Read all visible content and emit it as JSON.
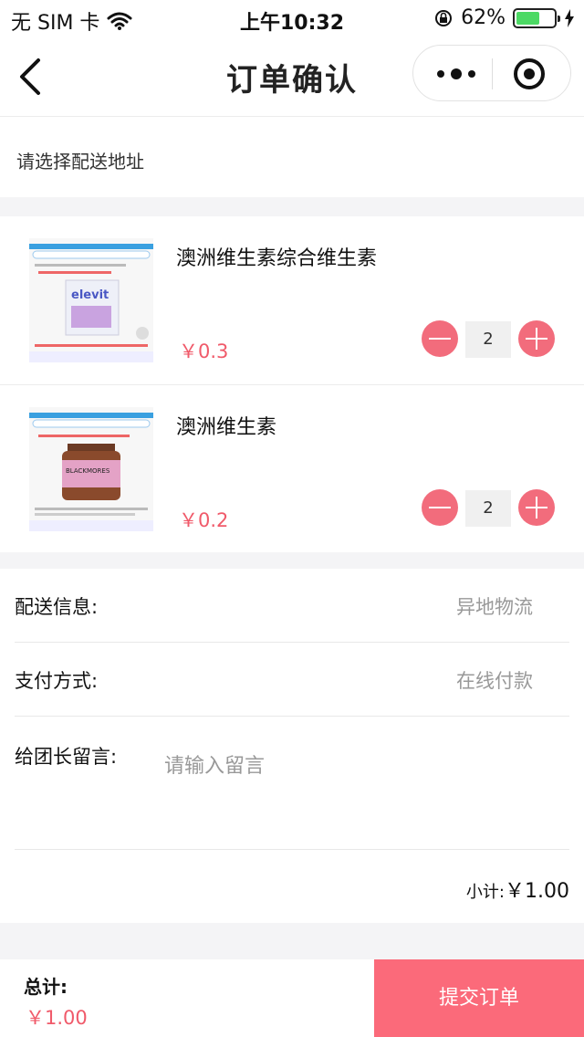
{
  "status_bar": {
    "carrier": "无 SIM 卡",
    "time": "上午10:32",
    "battery_percent": "62%",
    "battery_level": 0.62
  },
  "nav": {
    "title": "订单确认"
  },
  "address": {
    "prompt": "请选择配送地址"
  },
  "products": [
    {
      "name": "澳洲维生素综合维生素",
      "price": "￥0.3",
      "quantity": "2",
      "thumb_caption": "elevit"
    },
    {
      "name": "澳洲维生素",
      "price": "￥0.2",
      "quantity": "2",
      "thumb_caption": "BLACKMORES"
    }
  ],
  "info": {
    "delivery_label": "配送信息:",
    "delivery_value": "异地物流",
    "payment_label": "支付方式:",
    "payment_value": "在线付款",
    "memo_label": "给团长留言:",
    "memo_placeholder": "请输入留言",
    "subtotal_label": "小计:",
    "subtotal_value": "￥1.00"
  },
  "footer": {
    "total_label": "总计:",
    "total_value": "￥1.00",
    "submit_label": "提交订单"
  },
  "colors": {
    "accent": "#f26c7c",
    "price": "#f05a6a",
    "submit_bg": "#fb6a7a",
    "battery": "#4cd964"
  }
}
